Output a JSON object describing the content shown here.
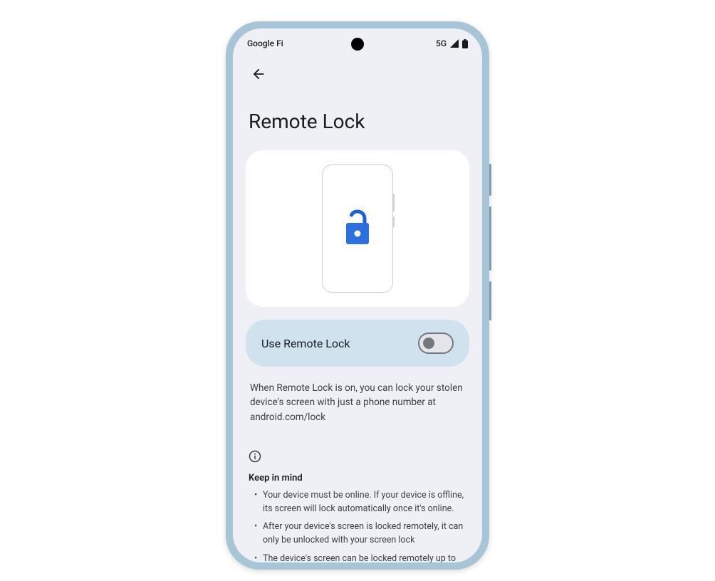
{
  "statusBar": {
    "carrier": "Google Fi",
    "network": "5G"
  },
  "page": {
    "title": "Remote Lock"
  },
  "toggle": {
    "label": "Use Remote Lock",
    "on": false
  },
  "description": "When Remote Lock is on, you can lock your stolen device's screen with just a phone number at android.com/lock",
  "keepInMind": {
    "title": "Keep in mind",
    "items": [
      "Your device must be online. If your device is offline, its screen will lock automatically once it's online.",
      "After your device's screen is locked remotely, it can only be unlocked with your screen lock",
      "The device's screen can be locked remotely up to"
    ]
  }
}
